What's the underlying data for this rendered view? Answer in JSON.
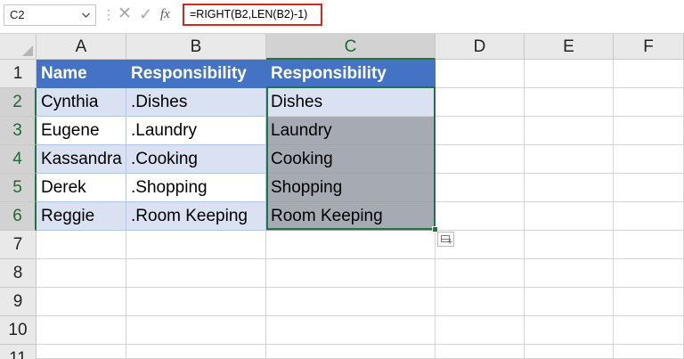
{
  "formula_bar": {
    "name_box": "C2",
    "dropdown_icon": "chevron-down-icon",
    "dots": "⋮",
    "cancel_glyph": "✕",
    "enter_glyph": "✓",
    "fx_label": "fx",
    "formula": "=RIGHT(B2,LEN(B2)-1)"
  },
  "columns": [
    "A",
    "B",
    "C",
    "D",
    "E",
    "F"
  ],
  "selected_column": "C",
  "rows": [
    "1",
    "2",
    "3",
    "4",
    "5",
    "6",
    "7",
    "8",
    "9",
    "10",
    "11"
  ],
  "selected_rows": [
    "2",
    "3",
    "4",
    "5",
    "6"
  ],
  "table": {
    "headers": [
      "Name",
      "Responsibility",
      "Responsibility"
    ],
    "data": [
      [
        "Cynthia",
        ".Dishes",
        "Dishes"
      ],
      [
        "Eugene",
        ".Laundry",
        "Laundry"
      ],
      [
        "Kassandra",
        ".Cooking",
        "Cooking"
      ],
      [
        "Derek",
        ".Shopping",
        "Shopping"
      ],
      [
        "Reggie",
        ".Room Keeping",
        "Room Keeping"
      ]
    ]
  },
  "colors": {
    "header_fill": "#4472c4",
    "band_fill": "#d9e1f2",
    "selection_fill": "#a6aab3",
    "selection_border": "#217346",
    "formula_highlight": "#d9261c"
  }
}
